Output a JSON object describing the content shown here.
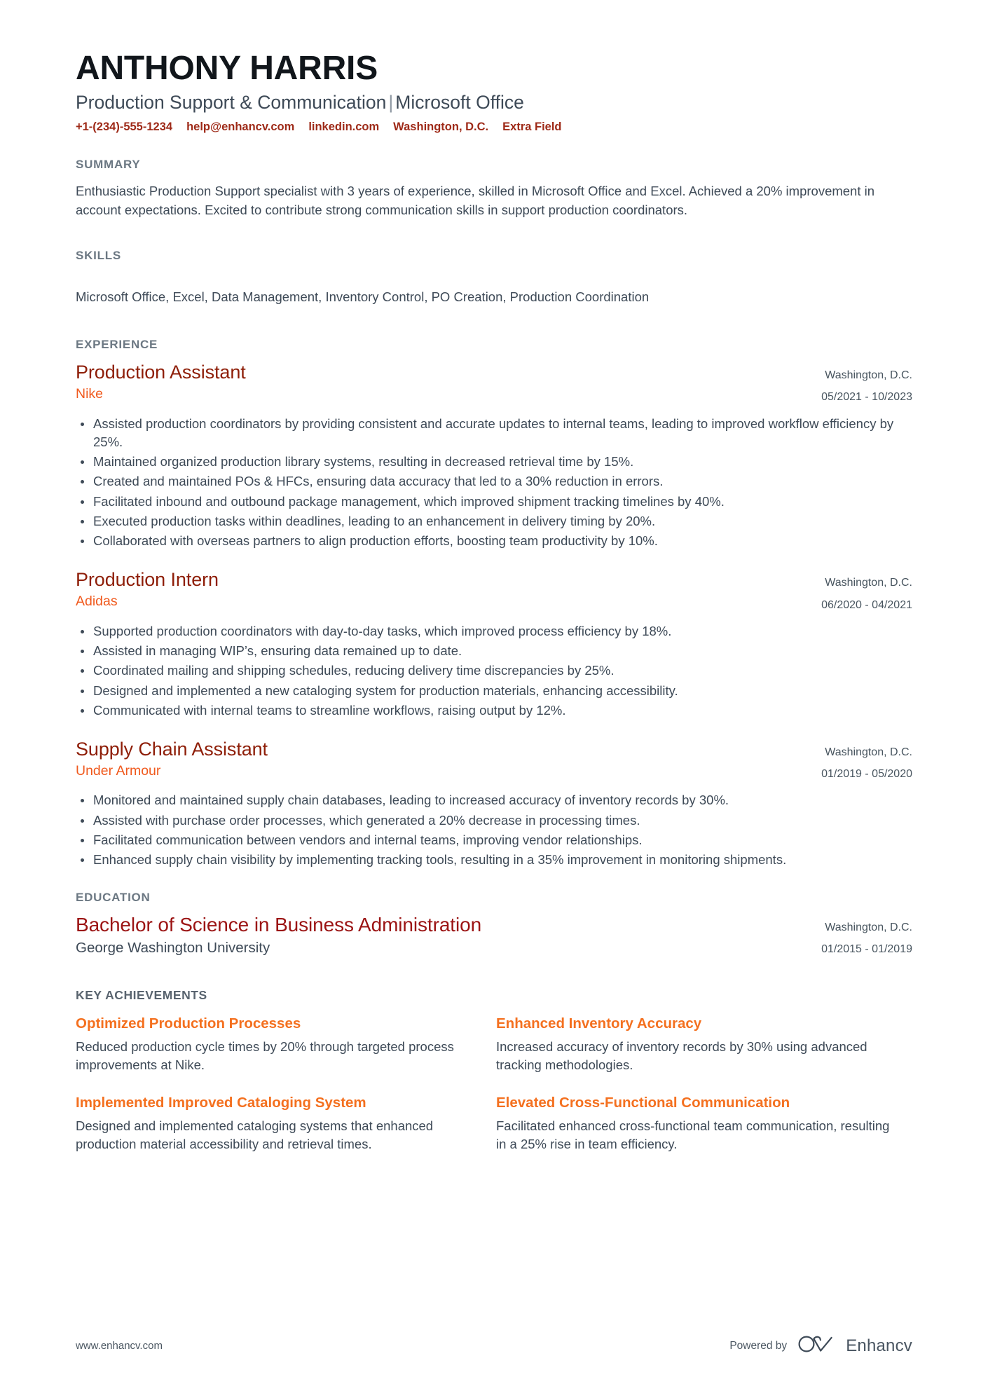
{
  "header": {
    "name": "ANTHONY HARRIS",
    "headline_left": "Production Support & Communication",
    "headline_divider": "|",
    "headline_right": "Microsoft Office",
    "contacts": [
      {
        "label": "+1-(234)-555-1234",
        "name": "phone"
      },
      {
        "label": "help@enhancv.com",
        "name": "email"
      },
      {
        "label": "linkedin.com",
        "name": "linkedin"
      },
      {
        "label": "Washington, D.C.",
        "name": "location"
      },
      {
        "label": "Extra Field",
        "name": "extra-field"
      }
    ]
  },
  "summary": {
    "title": "SUMMARY",
    "text": "Enthusiastic Production Support specialist with 3 years of experience, skilled in Microsoft Office and Excel. Achieved a 20% improvement in account expectations. Excited to contribute strong communication skills in support production coordinators."
  },
  "skills": {
    "title": "SKILLS",
    "list": "Microsoft Office, Excel, Data Management, Inventory Control, PO Creation, Production Coordination"
  },
  "experience": {
    "title": "EXPERIENCE",
    "entries": [
      {
        "role": "Production Assistant",
        "organization": "Nike",
        "location": "Washington, D.C.",
        "dates": "05/2021 - 10/2023",
        "bullets": [
          "Assisted production coordinators by providing consistent and accurate updates to internal teams, leading to improved workflow efficiency by 25%.",
          "Maintained organized production library systems, resulting in decreased retrieval time by 15%.",
          "Created and maintained POs & HFCs, ensuring data accuracy that led to a 30% reduction in errors.",
          "Facilitated inbound and outbound package management, which improved shipment tracking timelines by 40%.",
          "Executed production tasks within deadlines, leading to an enhancement in delivery timing by 20%.",
          "Collaborated with overseas partners to align production efforts, boosting team productivity by 10%."
        ]
      },
      {
        "role": "Production Intern",
        "organization": "Adidas",
        "location": "Washington, D.C.",
        "dates": "06/2020 - 04/2021",
        "bullets": [
          "Supported production coordinators with day-to-day tasks, which improved process efficiency by 18%.",
          "Assisted in managing WIP’s, ensuring data remained up to date.",
          "Coordinated mailing and shipping schedules, reducing delivery time discrepancies by 25%.",
          "Designed and implemented a new cataloging system for production materials, enhancing accessibility.",
          "Communicated with internal teams to streamline workflows, raising output by 12%."
        ]
      },
      {
        "role": "Supply Chain Assistant",
        "organization": "Under Armour",
        "location": "Washington, D.C.",
        "dates": "01/2019 - 05/2020",
        "bullets": [
          "Monitored and maintained supply chain databases, leading to increased accuracy of inventory records by 30%.",
          "Assisted with purchase order processes, which generated a 20% decrease in processing times.",
          "Facilitated communication between vendors and internal teams, improving vendor relationships.",
          "Enhanced supply chain visibility by implementing tracking tools, resulting in a 35% improvement in monitoring shipments."
        ]
      }
    ]
  },
  "education": {
    "title": "EDUCATION",
    "entries": [
      {
        "degree": "Bachelor of Science in Business Administration",
        "school": "George Washington University",
        "location": "Washington, D.C.",
        "dates": "01/2015 - 01/2019"
      }
    ]
  },
  "achievements": {
    "title": "KEY ACHIEVEMENTS",
    "items": [
      {
        "heading": "Optimized Production Processes",
        "body": "Reduced production cycle times by 20% through targeted process improvements at Nike."
      },
      {
        "heading": "Enhanced Inventory Accuracy",
        "body": "Increased accuracy of inventory records by 30% using advanced tracking methodologies."
      },
      {
        "heading": "Implemented Improved Cataloging System",
        "body": "Designed and implemented cataloging systems that enhanced production material accessibility and retrieval times."
      },
      {
        "heading": "Elevated Cross-Functional Communication",
        "body": "Facilitated enhanced cross-functional team communication, resulting in a 25% rise in team efficiency."
      }
    ]
  },
  "footer": {
    "url": "www.enhancv.com",
    "powered_by": "Powered by",
    "brand_name": "Enhancv",
    "brand_logo_icon": "enhancv-cv-infinity-icon"
  },
  "colors": {
    "role_red": "#8e1e08",
    "organization_orange": "#f05a1e",
    "achievement_orange": "#f4701f",
    "contact_red": "#9e2a18",
    "degree_red": "#9b1414",
    "section_label_gray": "#6c7883",
    "body_gray": "#3e4a57"
  }
}
